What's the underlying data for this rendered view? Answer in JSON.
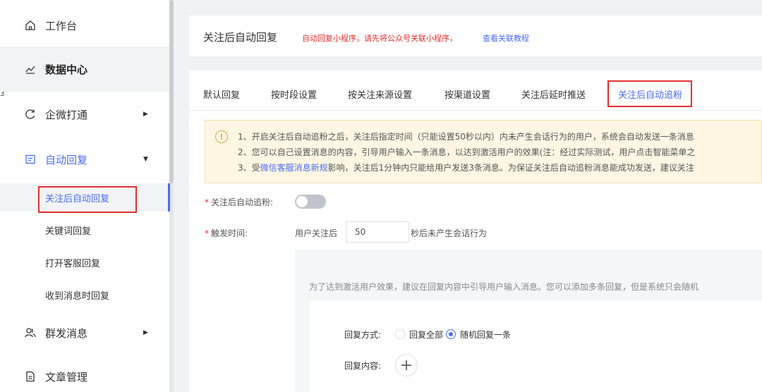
{
  "sidebar": {
    "edge_mark": "3",
    "items": [
      {
        "label": "工作台",
        "icon": "home-icon"
      },
      {
        "label": "数据中心",
        "icon": "line-chart-icon"
      },
      {
        "label": "企微打通",
        "icon": "refresh-icon"
      },
      {
        "label": "自动回复",
        "icon": "message-square-icon"
      },
      {
        "label": "群发消息",
        "icon": "users-icon"
      },
      {
        "label": "文章管理",
        "icon": "document-icon"
      }
    ],
    "sub_items": [
      {
        "label": "关注后自动回复"
      },
      {
        "label": "关键词回复"
      },
      {
        "label": "打开客服回复"
      },
      {
        "label": "收到消息时回复"
      }
    ]
  },
  "header": {
    "title": "关注后自动回复",
    "note": "自动回复小程序，请先将公众号关联小程序，",
    "link": "查看关联教程"
  },
  "tabs": [
    {
      "label": "默认回复"
    },
    {
      "label": "按时段设置"
    },
    {
      "label": "按关注来源设置"
    },
    {
      "label": "按渠道设置"
    },
    {
      "label": "关注后延时推送"
    },
    {
      "label": "关注后自动追粉"
    }
  ],
  "notice": {
    "line1": "1、开启关注后自动追粉之后，关注后指定时间（只能设置50秒以内）内未产生会话行为的用户，系统会自动发送一条消息",
    "line2": "2、您可以自己设置消息的内容，引导用户输入一条消息，以达到激活用户的效果(注：经过实际测试，用户点击智能菜单之",
    "line3_pre": "3、受",
    "line3_link": "微信客服消息新规",
    "line3_post": "影响，关注后1分钟内只能给用户发送3条消息。为保证关注后自动追粉消息能成功发送，建议关注"
  },
  "form": {
    "required_mark": "*",
    "follow_label": "关注后自动追粉:",
    "follow_enabled": false,
    "trigger_label": "触发时间:",
    "trigger_prefix": "用户关注后",
    "trigger_value": "50",
    "trigger_suffix": "秒后未产生会话行为",
    "panel_hint": "为了达到激活用户效果，建议在回复内容中引导用户输入消息。您可以添加多条回复，但是系统只会随机",
    "reply_mode_label": "回复方式:",
    "reply_all": "回复全部",
    "reply_random": "随机回复一条",
    "reply_content_label": "回复内容:",
    "plus_symbol": "+"
  },
  "colors": {
    "accent": "#4a6cf7",
    "alert": "#e0312f",
    "warning": "#e6a23c"
  }
}
